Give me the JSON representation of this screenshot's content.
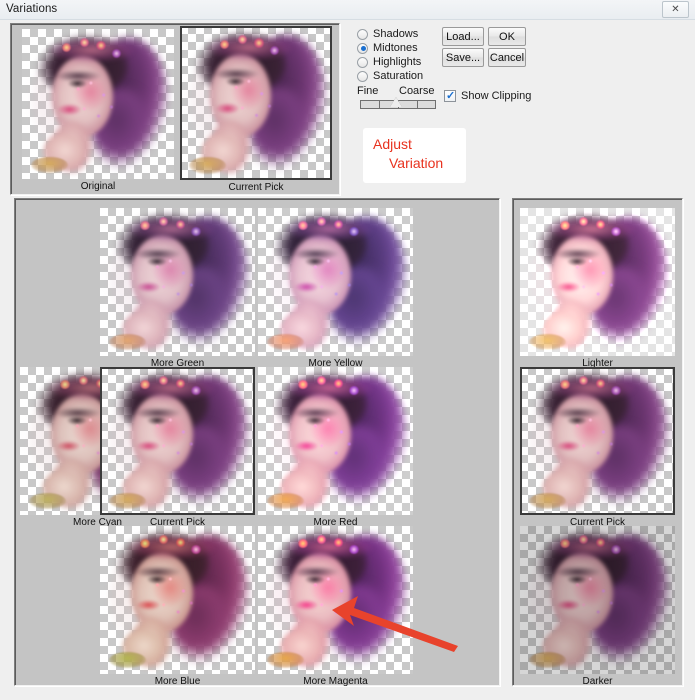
{
  "window": {
    "title": "Variations",
    "close_button_label": "✕",
    "close_icon_name": "close-icon"
  },
  "preview": {
    "thumbs": [
      {
        "label": "Original",
        "variant": "",
        "selected": false
      },
      {
        "label": "Current Pick",
        "variant": "",
        "selected": true
      }
    ]
  },
  "controls": {
    "radios": [
      {
        "label": "Shadows",
        "checked": false
      },
      {
        "label": "Midtones",
        "checked": true
      },
      {
        "label": "Highlights",
        "checked": false
      },
      {
        "label": "Saturation",
        "checked": false
      }
    ],
    "buttons": [
      {
        "label": "Load...",
        "name": "load-button"
      },
      {
        "label": "OK",
        "name": "ok-button"
      },
      {
        "label": "Save...",
        "name": "save-button"
      },
      {
        "label": "Cancel",
        "name": "cancel-button"
      }
    ],
    "slider": {
      "min_label": "Fine",
      "max_label": "Coarse",
      "ticks": 4,
      "position": 2
    },
    "checkbox": {
      "label": "Show Clipping",
      "checked": true
    }
  },
  "annotation": {
    "line1": "Adjust",
    "line2": "Variation",
    "color": "#e8321e",
    "arrow_color": "#e8432c"
  },
  "grid": {
    "cells": [
      {
        "label": "More Green",
        "variant": "v-green",
        "selected": false,
        "col": 1,
        "row": 0
      },
      {
        "label": "More Yellow",
        "variant": "v-yellow",
        "selected": false,
        "col": 2,
        "row": 0
      },
      {
        "label": "More Cyan",
        "variant": "v-cyan",
        "selected": false,
        "col": 0,
        "row": 1
      },
      {
        "label": "Current Pick",
        "variant": "",
        "selected": true,
        "col": 1,
        "row": 1
      },
      {
        "label": "More Red",
        "variant": "v-red",
        "selected": false,
        "col": 2,
        "row": 1
      },
      {
        "label": "More Blue",
        "variant": "v-blue",
        "selected": false,
        "col": 1,
        "row": 2
      },
      {
        "label": "More Magenta",
        "variant": "v-magenta",
        "selected": false,
        "col": 2,
        "row": 2
      }
    ]
  },
  "brightness": {
    "cells": [
      {
        "label": "Lighter",
        "variant": "v-lighter",
        "selected": false
      },
      {
        "label": "Current Pick",
        "variant": "",
        "selected": true
      },
      {
        "label": "Darker",
        "variant": "v-darker",
        "selected": false
      }
    ]
  },
  "colors": {
    "dialog_bg": "#efefef",
    "panel_bg": "#c4c4c4",
    "accent": "#1a6fd0",
    "annotation_red": "#e8321e"
  }
}
